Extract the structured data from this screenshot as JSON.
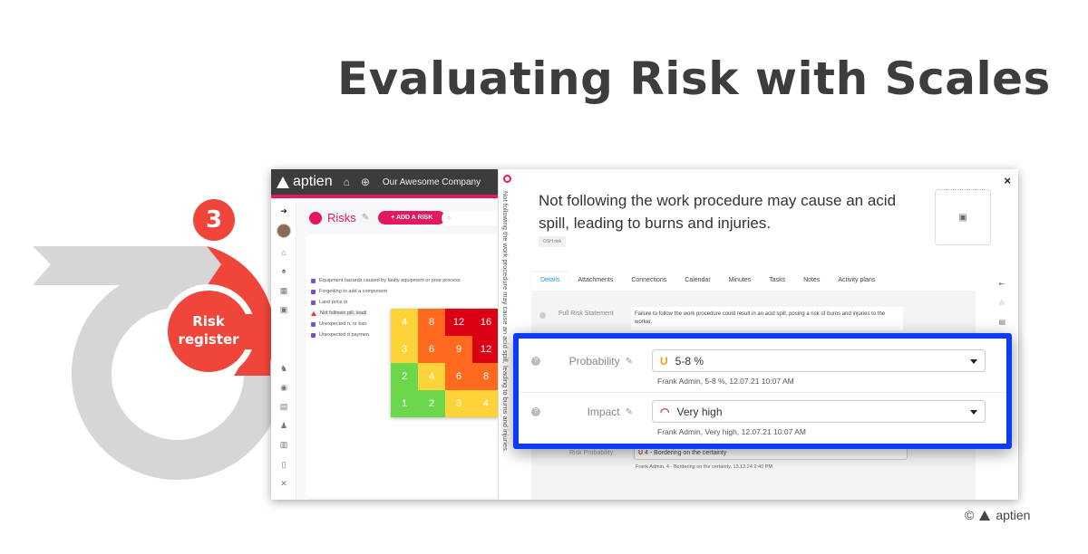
{
  "headline": "Evaluating Risk with Scales",
  "diagram": {
    "step_number": "3",
    "step_label_line1": "Risk",
    "step_label_line2": "register"
  },
  "app": {
    "logo_text": "aptien",
    "company": "Our Awesome Company",
    "risks_title": "Risks",
    "add_risk_label": "+ ADD A RISK",
    "search_icon": "search-icon",
    "risk_list": [
      {
        "icon": "risk-icon",
        "text": "Equipment hazards caused by faulty equipment or poor process"
      },
      {
        "icon": "risk-icon",
        "text": "Forgetting to add a component"
      },
      {
        "icon": "risk-icon",
        "text": "Land price in"
      },
      {
        "icon": "warning-icon",
        "text": "Not followin                                       pill, leadi"
      },
      {
        "icon": "risk-icon",
        "text": "Unexpected                                        n, or ban"
      },
      {
        "icon": "risk-icon",
        "text": "Unexpected                                        d paymen"
      }
    ],
    "matrix": {
      "rows": [
        [
          {
            "v": "4",
            "c": "#fdd33a"
          },
          {
            "v": "8",
            "c": "#ff6a1f"
          },
          {
            "v": "12",
            "c": "#dc0014"
          },
          {
            "v": "16",
            "c": "#dc0014"
          }
        ],
        [
          {
            "v": "3",
            "c": "#fdd33a"
          },
          {
            "v": "6",
            "c": "#ff6a1f"
          },
          {
            "v": "9",
            "c": "#ff6a1f"
          },
          {
            "v": "12",
            "c": "#dc0014"
          }
        ],
        [
          {
            "v": "2",
            "c": "#6ad84a"
          },
          {
            "v": "4",
            "c": "#fdd33a"
          },
          {
            "v": "6",
            "c": "#ff6a1f"
          },
          {
            "v": "8",
            "c": "#ff6a1f"
          }
        ],
        [
          {
            "v": "1",
            "c": "#6ad84a"
          },
          {
            "v": "2",
            "c": "#6ad84a"
          },
          {
            "v": "3",
            "c": "#fdd33a"
          },
          {
            "v": "4",
            "c": "#fdd33a"
          }
        ]
      ]
    },
    "vertical_title": "Not following the work procedure may cause an acid spill, leading to burns and injuries.",
    "detail": {
      "title": "Not following the work procedure may cause an acid spill, leading to burns and injuries.",
      "tag": "OSH risk",
      "close": "×",
      "tabs": [
        "Details",
        "Attachments",
        "Connections",
        "Calendar",
        "Minutes",
        "Tasks",
        "Notes",
        "Activity plans"
      ],
      "full_risk_statement_label": "Full Risk Statement",
      "full_risk_statement_value": "Failure to follow the work procedure could result in an acid spill, posing a risk of burns and injuries to the worker.",
      "risk_probability_label": "Risk Probability",
      "risk_probability_value": "4 - Bordering on the certainty",
      "risk_probability_meta": "Frank Admin, 4 - Bordering on the certainty, 13.12.24 2:40 PM"
    }
  },
  "highlight": {
    "probability": {
      "label": "Probability",
      "value": "5-8 %",
      "meta": "Frank Admin, 5-8 %, 12.07.21 10:07 AM",
      "icon_color": "#f39c12"
    },
    "impact": {
      "label": "Impact",
      "value": "Very high",
      "meta": "Frank Admin, Very high, 12.07.21 10:07 AM",
      "icon_color": "#e53935"
    }
  },
  "footer": {
    "copyright": "©",
    "brand": "aptien"
  }
}
